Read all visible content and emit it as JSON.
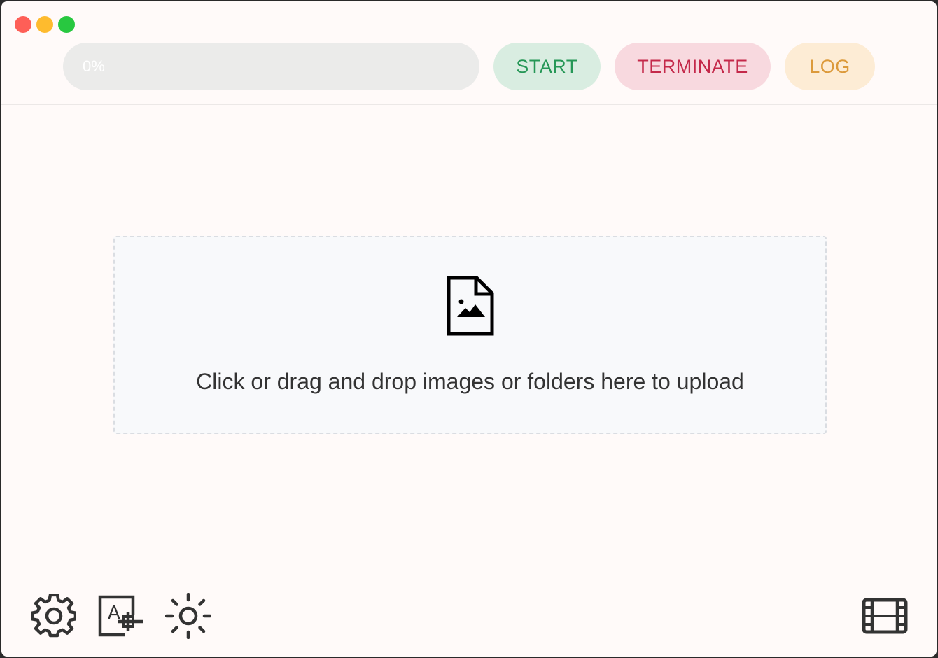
{
  "window": {
    "traffic_lights": [
      "close",
      "minimize",
      "maximize"
    ]
  },
  "toolbar": {
    "progress": 0,
    "progress_text": "0%",
    "start_label": "START",
    "terminate_label": "TERMINATE",
    "log_label": "LOG"
  },
  "dropzone": {
    "icon": "image-file-icon",
    "text": "Click or drag and drop images or folders here to upload"
  },
  "footer": {
    "icons": [
      "gear-icon",
      "font-add-icon",
      "sun-icon",
      "film-icon"
    ]
  },
  "colors": {
    "start": "#259756",
    "terminate": "#c4294a",
    "log": "#dc9a3b"
  }
}
